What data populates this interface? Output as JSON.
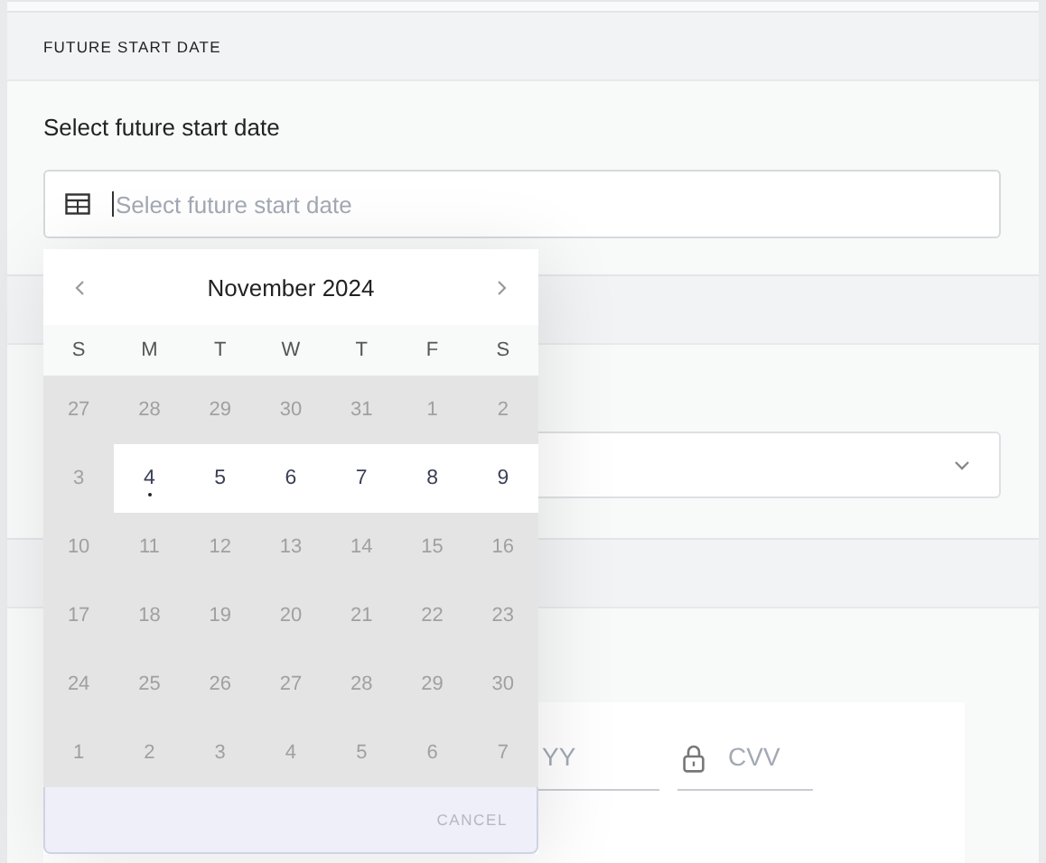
{
  "start_date": {
    "title": "FUTURE START DATE",
    "label": "Select future start date",
    "field": {
      "placeholder": "Select future start date"
    }
  },
  "plan": {
    "dropdown": {
      "expanded": false
    }
  },
  "payment": {
    "expiry": {
      "placeholder": "YY"
    },
    "cvv": {
      "placeholder": "CVV"
    }
  },
  "datepicker": {
    "month": "November 2024",
    "weekdays": [
      "S",
      "M",
      "T",
      "W",
      "T",
      "F",
      "S"
    ],
    "weeks": [
      [
        {
          "day": "27",
          "enabled": false,
          "today": false
        },
        {
          "day": "28",
          "enabled": false,
          "today": false
        },
        {
          "day": "29",
          "enabled": false,
          "today": false
        },
        {
          "day": "30",
          "enabled": false,
          "today": false
        },
        {
          "day": "31",
          "enabled": false,
          "today": false
        },
        {
          "day": "1",
          "enabled": false,
          "today": false
        },
        {
          "day": "2",
          "enabled": false,
          "today": false
        }
      ],
      [
        {
          "day": "3",
          "enabled": false,
          "today": false
        },
        {
          "day": "4",
          "enabled": true,
          "today": true
        },
        {
          "day": "5",
          "enabled": true,
          "today": false
        },
        {
          "day": "6",
          "enabled": true,
          "today": false
        },
        {
          "day": "7",
          "enabled": true,
          "today": false
        },
        {
          "day": "8",
          "enabled": true,
          "today": false
        },
        {
          "day": "9",
          "enabled": true,
          "today": false
        }
      ],
      [
        {
          "day": "10",
          "enabled": false,
          "today": false
        },
        {
          "day": "11",
          "enabled": false,
          "today": false
        },
        {
          "day": "12",
          "enabled": false,
          "today": false
        },
        {
          "day": "13",
          "enabled": false,
          "today": false
        },
        {
          "day": "14",
          "enabled": false,
          "today": false
        },
        {
          "day": "15",
          "enabled": false,
          "today": false
        },
        {
          "day": "16",
          "enabled": false,
          "today": false
        }
      ],
      [
        {
          "day": "17",
          "enabled": false,
          "today": false
        },
        {
          "day": "18",
          "enabled": false,
          "today": false
        },
        {
          "day": "19",
          "enabled": false,
          "today": false
        },
        {
          "day": "20",
          "enabled": false,
          "today": false
        },
        {
          "day": "21",
          "enabled": false,
          "today": false
        },
        {
          "day": "22",
          "enabled": false,
          "today": false
        },
        {
          "day": "23",
          "enabled": false,
          "today": false
        }
      ],
      [
        {
          "day": "24",
          "enabled": false,
          "today": false
        },
        {
          "day": "25",
          "enabled": false,
          "today": false
        },
        {
          "day": "26",
          "enabled": false,
          "today": false
        },
        {
          "day": "27",
          "enabled": false,
          "today": false
        },
        {
          "day": "28",
          "enabled": false,
          "today": false
        },
        {
          "day": "29",
          "enabled": false,
          "today": false
        },
        {
          "day": "30",
          "enabled": false,
          "today": false
        }
      ],
      [
        {
          "day": "1",
          "enabled": false,
          "today": false
        },
        {
          "day": "2",
          "enabled": false,
          "today": false
        },
        {
          "day": "3",
          "enabled": false,
          "today": false
        },
        {
          "day": "4",
          "enabled": false,
          "today": false
        },
        {
          "day": "5",
          "enabled": false,
          "today": false
        },
        {
          "day": "6",
          "enabled": false,
          "today": false
        },
        {
          "day": "7",
          "enabled": false,
          "today": false
        }
      ]
    ],
    "cancel": "CANCEL"
  }
}
